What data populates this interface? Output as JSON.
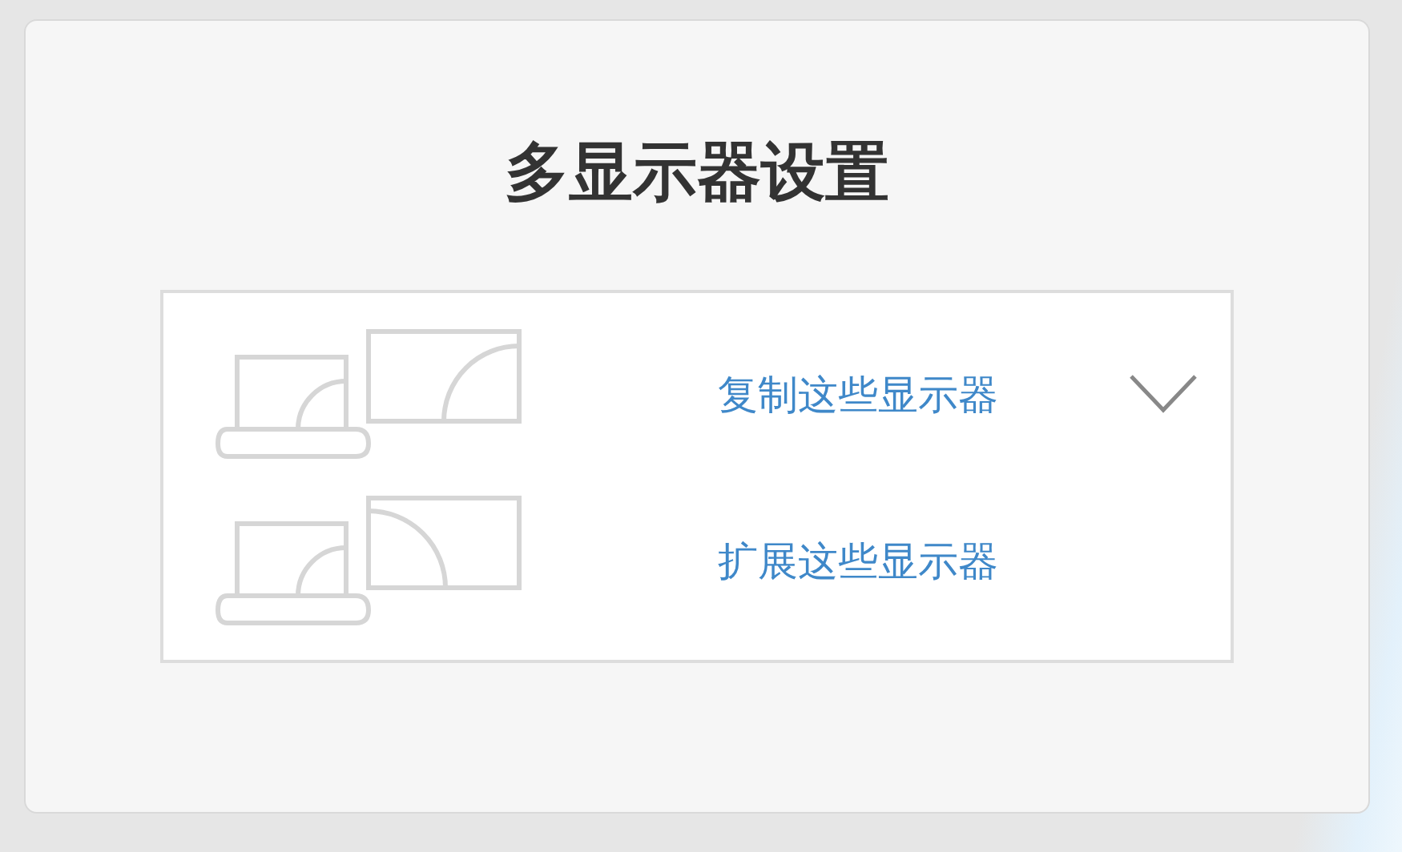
{
  "title": "多显示器设置",
  "dropdown": {
    "expanded": true,
    "options": [
      {
        "label": "复制这些显示器",
        "kind": "duplicate"
      },
      {
        "label": "扩展这些显示器",
        "kind": "extend"
      }
    ]
  }
}
